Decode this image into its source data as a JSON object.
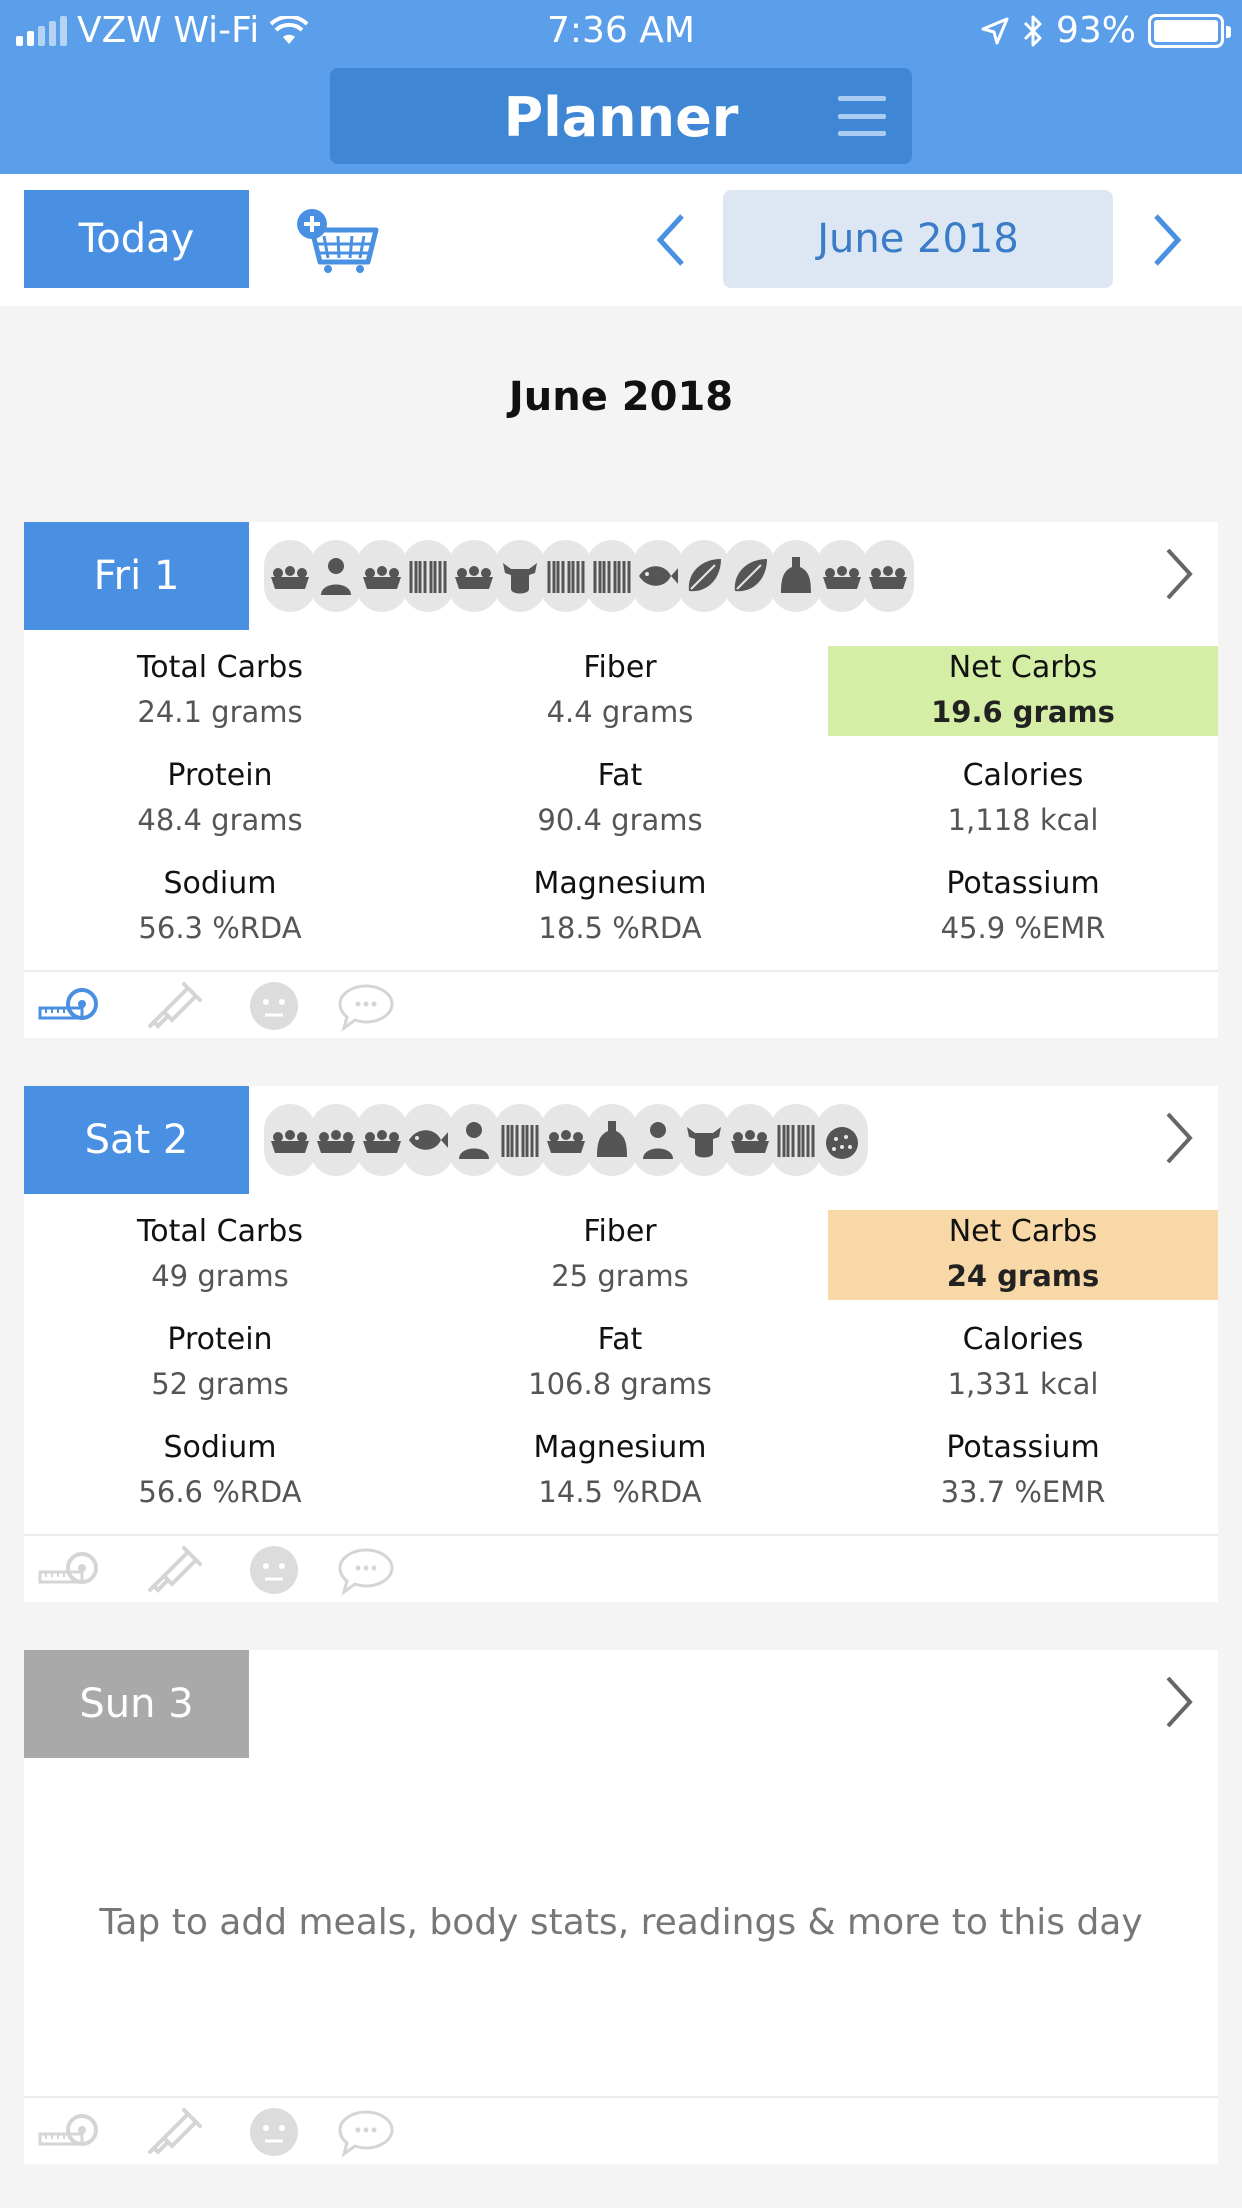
{
  "status_bar": {
    "carrier": "VZW Wi-Fi",
    "time": "7:36 AM",
    "battery": "93%"
  },
  "header": {
    "title": "Planner"
  },
  "toolbar": {
    "today_label": "Today",
    "month_label": "June 2018"
  },
  "month_heading": "June 2018",
  "days": [
    {
      "label": "Fri 1",
      "icons": [
        "egg-carton-icon",
        "person-icon",
        "egg-carton-icon",
        "barcode-icon",
        "egg-carton-icon",
        "cow-icon",
        "barcode-icon",
        "barcode-icon",
        "fish-icon",
        "leaf-icon",
        "leaf-icon",
        "oil-bottle-icon",
        "egg-carton-icon",
        "egg-carton-icon"
      ],
      "stats": {
        "total_carbs": {
          "label": "Total Carbs",
          "value": "24.1 grams"
        },
        "fiber": {
          "label": "Fiber",
          "value": "4.4 grams"
        },
        "net_carbs": {
          "label": "Net Carbs",
          "value": "19.6 grams"
        },
        "protein": {
          "label": "Protein",
          "value": "48.4 grams"
        },
        "fat": {
          "label": "Fat",
          "value": "90.4 grams"
        },
        "calories": {
          "label": "Calories",
          "value": "1,118 kcal"
        },
        "sodium": {
          "label": "Sodium",
          "value": "56.3 %RDA"
        },
        "magnesium": {
          "label": "Magnesium",
          "value": "18.5 %RDA"
        },
        "potassium": {
          "label": "Potassium",
          "value": "45.9 %EMR"
        }
      },
      "net_carbs_color": "#d4efa5"
    },
    {
      "label": "Sat 2",
      "icons": [
        "egg-carton-icon",
        "egg-carton-icon",
        "egg-carton-icon",
        "fish-icon",
        "person-icon",
        "barcode-icon",
        "egg-carton-icon",
        "oil-bottle-icon",
        "person-icon",
        "cow-icon",
        "egg-carton-icon",
        "barcode-icon",
        "berry-icon"
      ],
      "stats": {
        "total_carbs": {
          "label": "Total Carbs",
          "value": "49 grams"
        },
        "fiber": {
          "label": "Fiber",
          "value": "25 grams"
        },
        "net_carbs": {
          "label": "Net Carbs",
          "value": "24 grams"
        },
        "protein": {
          "label": "Protein",
          "value": "52 grams"
        },
        "fat": {
          "label": "Fat",
          "value": "106.8 grams"
        },
        "calories": {
          "label": "Calories",
          "value": "1,331 kcal"
        },
        "sodium": {
          "label": "Sodium",
          "value": "56.6 %RDA"
        },
        "magnesium": {
          "label": "Magnesium",
          "value": "14.5 %RDA"
        },
        "potassium": {
          "label": "Potassium",
          "value": "33.7 %EMR"
        }
      },
      "net_carbs_color": "#f8d8a7"
    },
    {
      "label": "Sun 3",
      "empty_message": "Tap to add meals, body stats, readings & more to this day"
    }
  ],
  "colors": {
    "header_blue": "#5b9ee9",
    "accent_blue": "#4a90e2",
    "inactive_gray": "#a9a9a9"
  }
}
